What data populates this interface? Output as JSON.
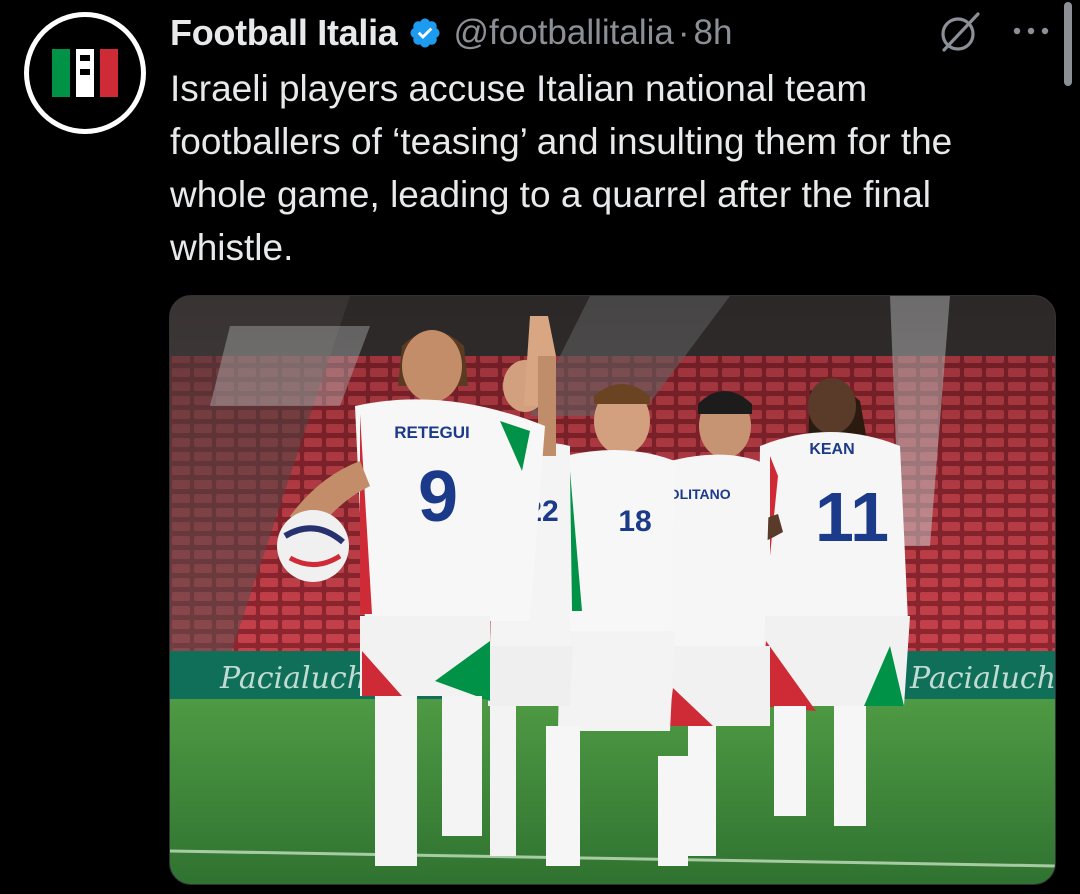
{
  "tweet": {
    "author": {
      "display_name": "Football Italia",
      "handle": "@footballitalia",
      "verified": true,
      "avatar_icon": "football-italia-logo"
    },
    "separator": "·",
    "time": "8h",
    "text": "Israeli players accuse Italian national team footballers of ‘teasing’ and insulting them for the whole game, leading to a quarrel after the final whistle.",
    "actions": {
      "grok_icon": "grok-icon",
      "more_icon": "more-options-icon"
    },
    "media": {
      "jersey_names": [
        "RETEGUI",
        "POLITANO",
        "KEAN"
      ],
      "jersey_numbers": [
        "9",
        "22",
        "18",
        "11"
      ],
      "board_text": "Pacialuchy"
    }
  },
  "colors": {
    "background": "#000000",
    "text_primary": "#e7e9ea",
    "text_secondary": "#8b9096",
    "verified_blue": "#1d9bf0",
    "italy_green": "#009246",
    "italy_red": "#ce2b37",
    "pitch_green": "#3f8a3a",
    "stand_red": "#b8333d"
  }
}
